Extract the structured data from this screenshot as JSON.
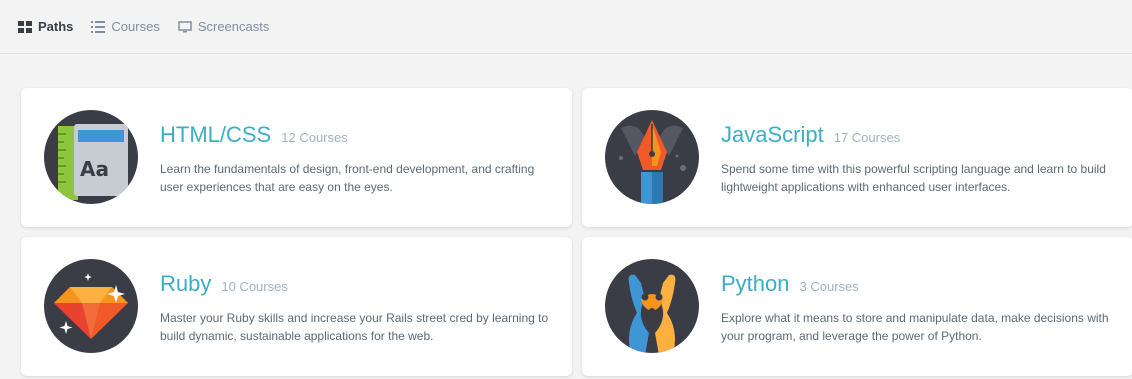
{
  "nav": {
    "items": [
      {
        "label": "Paths",
        "icon": "grid-icon",
        "active": true
      },
      {
        "label": "Courses",
        "icon": "list-icon",
        "active": false
      },
      {
        "label": "Screencasts",
        "icon": "monitor-icon",
        "active": false
      }
    ]
  },
  "cards": [
    {
      "name": "HTML/CSS",
      "count": "12 Courses",
      "description": "Learn the fundamentals of design, front-end development, and crafting user experiences that are easy on the eyes.",
      "icon": "html-css-badge-icon"
    },
    {
      "name": "JavaScript",
      "count": "17 Courses",
      "description": "Spend some time with this powerful scripting language and learn to build lightweight applications with enhanced user interfaces.",
      "icon": "javascript-pen-badge-icon"
    },
    {
      "name": "Ruby",
      "count": "10 Courses",
      "description": "Master your Ruby skills and increase your Rails street cred by learning to build dynamic, sustainable applications for the web.",
      "icon": "ruby-gem-badge-icon"
    },
    {
      "name": "Python",
      "count": "3 Courses",
      "description": "Explore what it means to store and manipulate data, make decisions with your program, and leverage the power of Python.",
      "icon": "python-snakes-badge-icon"
    }
  ],
  "colors": {
    "accent": "#3baec6",
    "count": "#9fb3c0",
    "text": "#5c6a76",
    "nav_active": "#384047",
    "nav_inactive": "#7e8fa1"
  }
}
